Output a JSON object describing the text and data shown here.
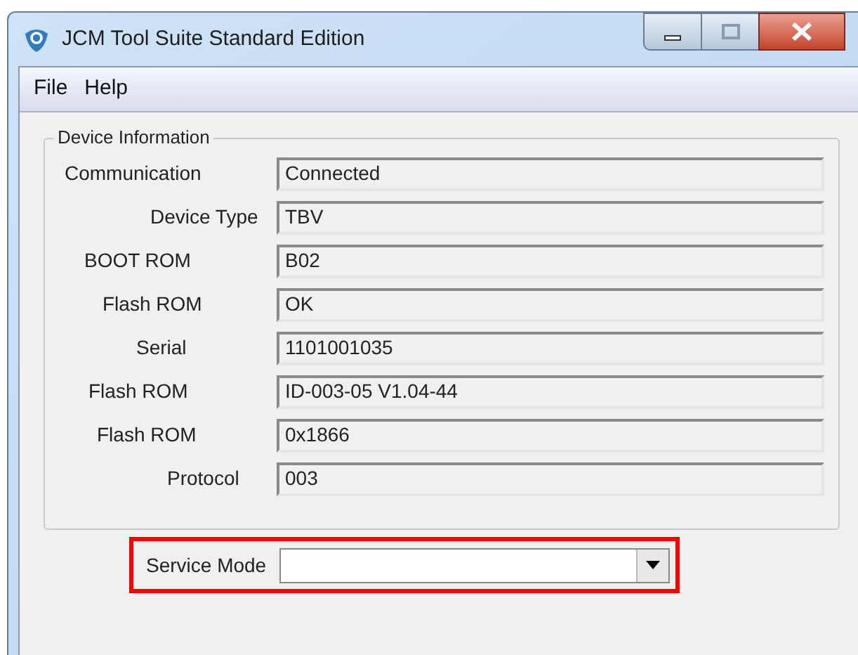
{
  "window": {
    "title": "JCM Tool Suite Standard Edition"
  },
  "menu": [
    "File",
    "Help"
  ],
  "device_information": {
    "title": "Device Information",
    "fields": [
      {
        "label": "Communication",
        "value": "Connected"
      },
      {
        "label": "Device Type",
        "value": "TBV"
      },
      {
        "label": "BOOT ROM",
        "value": "B02"
      },
      {
        "label": "Flash ROM",
        "value": "OK"
      },
      {
        "label": "Serial",
        "value": "1101001035"
      },
      {
        "label": "Flash ROM",
        "value": "ID-003-05 V1.04-44"
      },
      {
        "label": "Flash ROM",
        "value": "0x1866"
      },
      {
        "label": "Protocol",
        "value": "003"
      }
    ]
  },
  "service_mode": {
    "label": "Service Mode",
    "highlighted": true
  }
}
